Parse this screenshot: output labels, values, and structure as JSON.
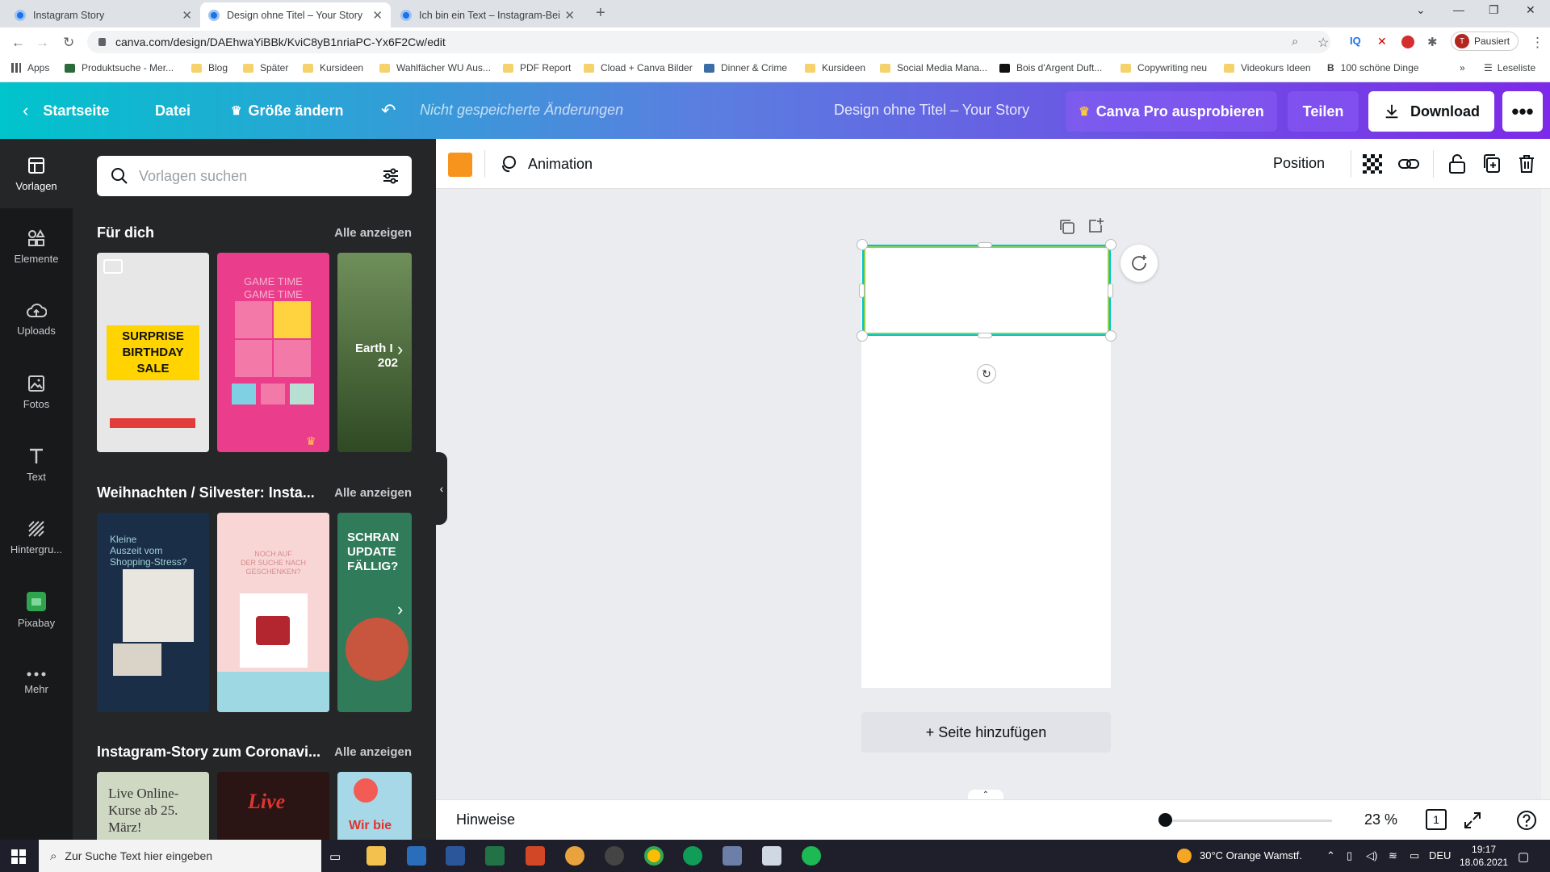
{
  "browser": {
    "tabs": [
      {
        "title": "Instagram Story",
        "active": false
      },
      {
        "title": "Design ohne Titel – Your Story",
        "active": true
      },
      {
        "title": "Ich bin ein Text – Instagram-Beit",
        "active": false
      }
    ],
    "url": "canva.com/design/DAEhwaYiBBk/KviC8yB1nriaPC-Yx6F2Cw/edit",
    "profile_letter": "T",
    "profile_status": "Pausiert",
    "bookmarks": [
      "Apps",
      "Produktsuche - Mer...",
      "Blog",
      "Später",
      "Kursideen",
      "Wahlfächer WU Aus...",
      "PDF Report",
      "Cload + Canva Bilder",
      "Dinner & Crime",
      "Kursideen",
      "Social Media Mana...",
      "Bois d'Argent Duft...",
      "Copywriting neu",
      "Videokurs Ideen",
      "100 schöne Dinge"
    ],
    "reading_list": "Leseliste"
  },
  "header": {
    "home": "Startseite",
    "file": "Datei",
    "resize": "Größe ändern",
    "unsaved": "Nicht gespeicherte Änderungen",
    "doc_title": "Design ohne Titel – Your Story",
    "pro": "Canva Pro ausprobieren",
    "share": "Teilen",
    "download": "Download",
    "colors": {
      "pro_bg": "#8b5cf6",
      "download_bg": "#ffffff"
    }
  },
  "sidebar": {
    "items": [
      {
        "label": "Vorlagen",
        "icon": "templates-icon"
      },
      {
        "label": "Elemente",
        "icon": "elements-icon"
      },
      {
        "label": "Uploads",
        "icon": "upload-icon"
      },
      {
        "label": "Fotos",
        "icon": "photos-icon"
      },
      {
        "label": "Text",
        "icon": "text-icon"
      },
      {
        "label": "Hintergru...",
        "icon": "background-icon"
      },
      {
        "label": "Pixabay",
        "icon": "pixabay-icon"
      },
      {
        "label": "Mehr",
        "icon": "more-icon"
      }
    ]
  },
  "panel": {
    "search_placeholder": "Vorlagen suchen",
    "sections": [
      {
        "title": "Für dich",
        "link": "Alle anzeigen",
        "thumbs": [
          {
            "lines": [
              "SURPRISE",
              "BIRTHDAY",
              "SALE"
            ],
            "bg": "#e7e7e7"
          },
          {
            "lines": [
              "GAME TIME",
              "GAME TIME"
            ],
            "bg": "#ea3d8c"
          },
          {
            "lines": [
              "Earth I",
              "202"
            ],
            "bg": "#3d5a2a"
          }
        ]
      },
      {
        "title": "Weihnachten / Silvester: Insta...",
        "link": "Alle anzeigen",
        "thumbs": [
          {
            "lines": [
              "Kleine",
              "Auszeit vom",
              "Shopping-Stress?"
            ],
            "bg": "#1b2e47"
          },
          {
            "lines": [
              "NOCH AUF",
              "DER SUCHE NACH",
              "GESCHENKEN?"
            ],
            "bg": "#f9d6d6"
          },
          {
            "lines": [
              "SCHRAN",
              "UPDATE",
              "FÄLLIG?"
            ],
            "bg": "#2f7b5a"
          }
        ]
      },
      {
        "title": "Instagram-Story zum Coronavi...",
        "link": "Alle anzeigen",
        "thumbs": [
          {
            "lines": [
              "Live Online-",
              "Kurse ab 25.",
              "März!"
            ],
            "bg": "#cfd8c3"
          },
          {
            "lines": [
              "Live"
            ],
            "bg": "#2a1414"
          },
          {
            "lines": [
              "Wir bie"
            ],
            "bg": "#a7d8e8"
          }
        ]
      }
    ]
  },
  "toolbar": {
    "color": "#f7941d",
    "animation": "Animation",
    "position": "Position"
  },
  "canvas": {
    "add_page": "+ Seite hinzufügen"
  },
  "bottom": {
    "notes": "Hinweise",
    "zoom": "23 %",
    "zoom_fraction": 0.05,
    "page_count": "1"
  },
  "taskbar": {
    "search_placeholder": "Zur Suche Text hier eingeben",
    "weather": "30°C  Orange Wamstf.",
    "lang": "DEU",
    "time": "19:17",
    "date": "18.06.2021"
  }
}
